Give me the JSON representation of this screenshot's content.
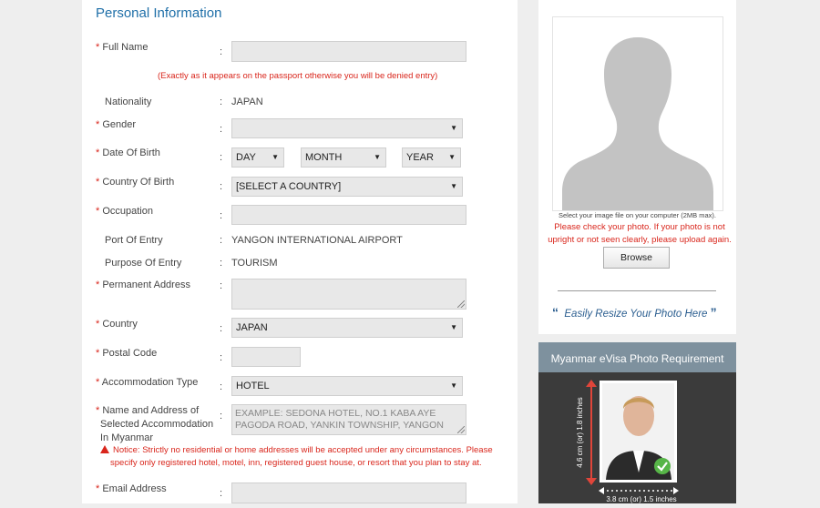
{
  "form": {
    "section_title": "Personal Information",
    "required_mark": "*",
    "colon": ":",
    "full_name": {
      "label": "Full Name",
      "value": "",
      "note": "(Exactly as it appears on the passport otherwise you will be denied entry)"
    },
    "nationality": {
      "label": "Nationality",
      "value": "JAPAN"
    },
    "gender": {
      "label": "Gender",
      "value": ""
    },
    "dob": {
      "label": "Date Of Birth",
      "day": "DAY",
      "month": "MONTH",
      "year": "YEAR"
    },
    "country_of_birth": {
      "label": "Country Of Birth",
      "value": "[SELECT A COUNTRY]"
    },
    "occupation": {
      "label": "Occupation",
      "value": ""
    },
    "port_of_entry": {
      "label": "Port Of Entry",
      "value": "YANGON INTERNATIONAL AIRPORT"
    },
    "purpose_of_entry": {
      "label": "Purpose Of Entry",
      "value": "TOURISM"
    },
    "permanent_address": {
      "label": "Permanent Address",
      "value": ""
    },
    "country": {
      "label": "Country",
      "value": "JAPAN"
    },
    "postal_code": {
      "label": "Postal Code",
      "value": ""
    },
    "accommodation_type": {
      "label": "Accommodation Type",
      "value": "HOTEL"
    },
    "accommodation_name": {
      "label_line1": "Name and Address of",
      "label_line2": "Selected Accommodation",
      "label_line3": "In Myanmar",
      "placeholder": "EXAMPLE: SEDONA HOTEL, NO.1 KABA AYE PAGODA ROAD, YANKIN TOWNSHIP, YANGON",
      "notice_line1": "Notice: Strictly no residential or home addresses will be accepted under any circumstances. Please",
      "notice_line2": "specify only registered hotel, motel, inn, registered guest house, or resort that you plan to stay at."
    },
    "email": {
      "label": "Email Address",
      "value": ""
    }
  },
  "photo": {
    "select_note": "Select your image file on your computer (2MB max).",
    "warning_line1": "Please check your photo. If your photo is not",
    "warning_line2": "upright or not seen clearly, please upload again.",
    "browse_label": "Browse",
    "resize_link": "Easily Resize Your Photo Here",
    "quote_open": "“",
    "quote_close": "”"
  },
  "requirement": {
    "title": "Myanmar eVisa Photo Requirement",
    "height_label": "4.6 cm (or) 1.8 inches",
    "width_label": "3.8 cm (or) 1.5 inches"
  },
  "colors": {
    "accent_blue": "#1f6fa8",
    "required_red": "#d9261c",
    "input_bg": "#e8e8e8"
  }
}
